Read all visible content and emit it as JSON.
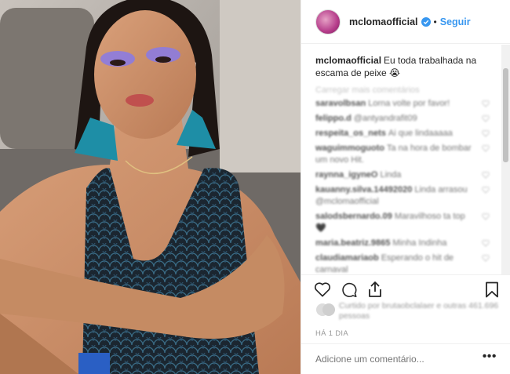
{
  "header": {
    "username": "mcloma​official",
    "separator": "•",
    "follow_label": "Seguir"
  },
  "caption": {
    "username": "mclomaofficial",
    "text": "Eu toda trabalhada na escama de peixe 😭"
  },
  "comments": {
    "load_more": "Carregar mais comentários",
    "items": [
      {
        "user": "saravolbsan",
        "text": "Lorna volte por favor!"
      },
      {
        "user": "felippo.d",
        "text": "@antyandrafit09"
      },
      {
        "user": "respeita_os_nets",
        "text": "Ai que lindaaaaa"
      },
      {
        "user": "waguimmoguoto",
        "text": "Ta na hora de bombar um novo Hit."
      },
      {
        "user": "raynna_igyneO",
        "text": "Linda"
      },
      {
        "user": "kauanny.silva.14492020",
        "text": "Linda arrasou @mclomaofficial"
      },
      {
        "user": "salodsbernardo.09",
        "text": "Maravilhoso ta top🖤"
      },
      {
        "user": "maria.beatriz.9865",
        "text": "Minha Indinha"
      },
      {
        "user": "claudiamariaob",
        "text": "Esperando o hit de carnaval"
      }
    ]
  },
  "actions": {
    "like_icon": "heart-icon",
    "comment_icon": "comment-icon",
    "share_icon": "share-icon",
    "save_icon": "bookmark-icon"
  },
  "likes_text": "Curtido por brutaobclalaer e outras 461.696 pessoas",
  "timestamp": "HÁ 1 DIA",
  "add_comment": {
    "placeholder": "Adicione um comentário...",
    "more_label": "•••"
  },
  "colors": {
    "accent": "#3897f0",
    "text": "#262626",
    "muted": "#999999",
    "border": "#efefef"
  }
}
